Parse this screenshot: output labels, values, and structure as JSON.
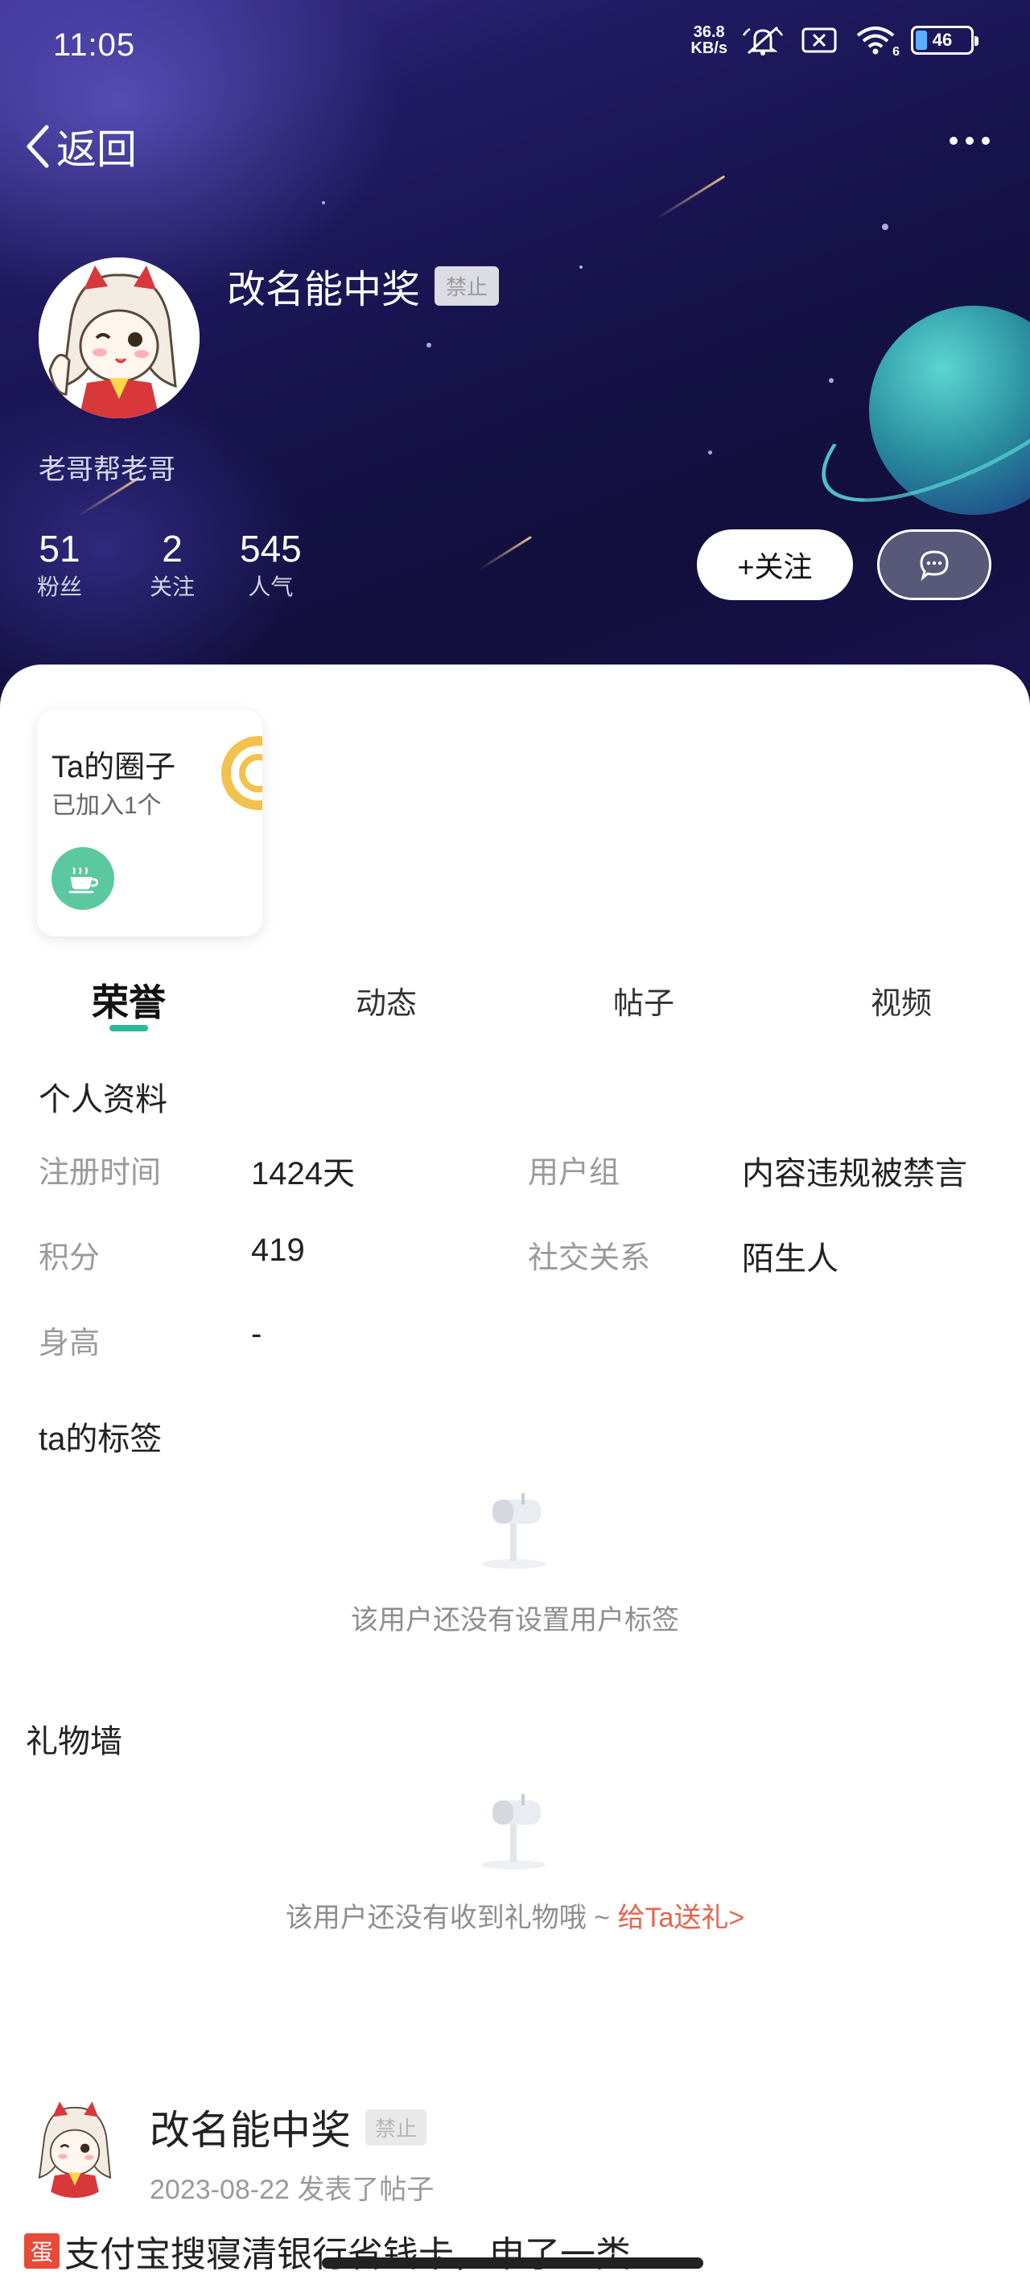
{
  "status_bar": {
    "time": "11:05",
    "net_speed_value": "36.8",
    "net_speed_unit": "KB/s",
    "wifi_sub": "6",
    "battery": "46",
    "icons": [
      "mute-bell-icon",
      "no-sim-icon",
      "wifi-icon",
      "battery-icon"
    ]
  },
  "header": {
    "back_label": "返回",
    "more_icon": "more-dots-icon"
  },
  "profile": {
    "name": "改名能中奖",
    "status_badge": "禁止",
    "signature": "老哥帮老哥",
    "stats": [
      {
        "value": "51",
        "label": "粉丝"
      },
      {
        "value": "2",
        "label": "关注"
      },
      {
        "value": "545",
        "label": "人气"
      }
    ],
    "follow_button": "+关注",
    "message_icon": "chat-bubble-icon"
  },
  "circle": {
    "title": "Ta的圈子",
    "subtitle": "已加入1个",
    "icon": "tea-cup-icon"
  },
  "tabs": [
    {
      "label": "荣誉",
      "active": true
    },
    {
      "label": "动态",
      "active": false
    },
    {
      "label": "帖子",
      "active": false
    },
    {
      "label": "视频",
      "active": false
    }
  ],
  "personal_info": {
    "title": "个人资料",
    "fields": [
      {
        "label": "注册时间",
        "value": "1424天"
      },
      {
        "label": "用户组",
        "value": "内容违规被禁言"
      },
      {
        "label": "积分",
        "value": "419"
      },
      {
        "label": "社交关系",
        "value": "陌生人"
      },
      {
        "label": "身高",
        "value": "-"
      }
    ]
  },
  "tags_section": {
    "title": "ta的标签",
    "empty_text": "该用户还没有设置用户标签"
  },
  "gift_section": {
    "title": "礼物墙",
    "empty_text": "该用户还没有收到礼物哦 ~ ",
    "gift_link": "给Ta送礼>"
  },
  "post": {
    "author": "改名能中奖",
    "author_badge": "禁止",
    "date": "2023-08-22",
    "action": "发表了帖子",
    "tag": "蛋",
    "title_preview": "支付宝搜寝清银行省钱卡，申了一类"
  },
  "colors": {
    "accent": "#2bb79a",
    "link": "#e8634d",
    "hero_bg": "#16124a"
  }
}
